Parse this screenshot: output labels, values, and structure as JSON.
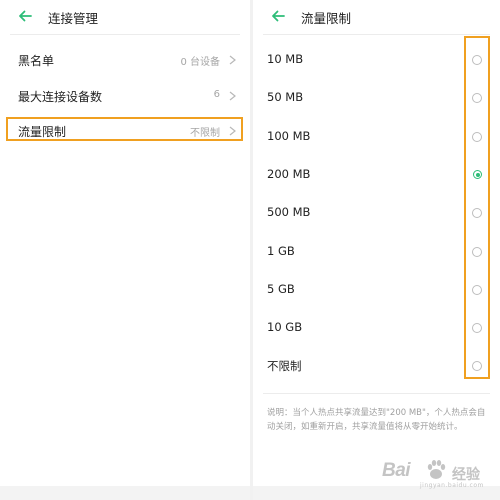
{
  "left_panel": {
    "header": {
      "title": "连接管理"
    },
    "rows": [
      {
        "label": "黑名单",
        "value": "0 台设备"
      },
      {
        "label": "最大连接设备数",
        "value": "6"
      },
      {
        "label": "流量限制",
        "value": "不限制"
      }
    ]
  },
  "right_panel": {
    "header": {
      "title": "流量限制"
    },
    "options": [
      {
        "label": "10 MB",
        "selected": false
      },
      {
        "label": "50 MB",
        "selected": false
      },
      {
        "label": "100 MB",
        "selected": false
      },
      {
        "label": "200 MB",
        "selected": true
      },
      {
        "label": "500 MB",
        "selected": false
      },
      {
        "label": "1 GB",
        "selected": false
      },
      {
        "label": "5 GB",
        "selected": false
      },
      {
        "label": "10 GB",
        "selected": false
      },
      {
        "label": "不限制",
        "selected": false
      }
    ],
    "note": "说明：当个人热点共享流量达到\"200 MB\"，个人热点会自动关闭，如重新开启，共享流量值将从零开始统计。"
  },
  "watermark": {
    "brand": "Bai",
    "cn_text": "经验",
    "sub_text": "jingyan.baidu.com"
  },
  "colors": {
    "accent_green": "#2dbd78",
    "highlight_orange": "#f0a020"
  }
}
